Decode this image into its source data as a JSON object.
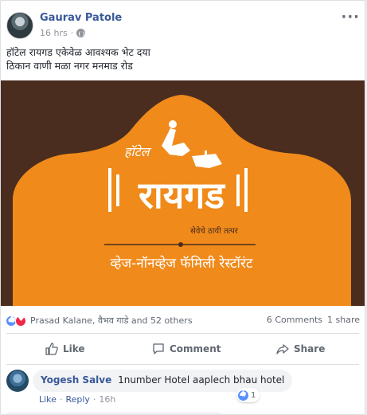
{
  "post": {
    "author": "Gaurav Patole",
    "time": "16 hrs",
    "privacy_icon": "globe-icon",
    "text_line1": "हॉटेल रायगड एकेवेळ आवश्यक भेट दया",
    "text_line2": "ठिकान वाणी मळा नगर मनमाड रोड",
    "more_icon": "ellipsis-icon"
  },
  "banner": {
    "brand_prefix": "हॉटेल",
    "brand_name": "रायगड",
    "tagline": "सेवेचे ठायी तत्पर",
    "subtitle": "व्हेज-नॉनव्हेज फॅमिली रेस्टॉरंट",
    "colors": {
      "background": "#4a2d1f",
      "arch": "#f08a1a",
      "text": "#ffffff"
    }
  },
  "reactions": {
    "names": "Prasad Kalane, वैभव गाडे and 52 others",
    "comments": "6 Comments",
    "shares": "1 share"
  },
  "actions": {
    "like": "Like",
    "comment": "Comment",
    "share": "Share"
  },
  "comment": {
    "author": "Yogesh Salve",
    "text": "1number Hotel aaplech bhau hotel",
    "like_count": "1",
    "like_link": "Like",
    "reply_link": "Reply",
    "time": "16h"
  }
}
